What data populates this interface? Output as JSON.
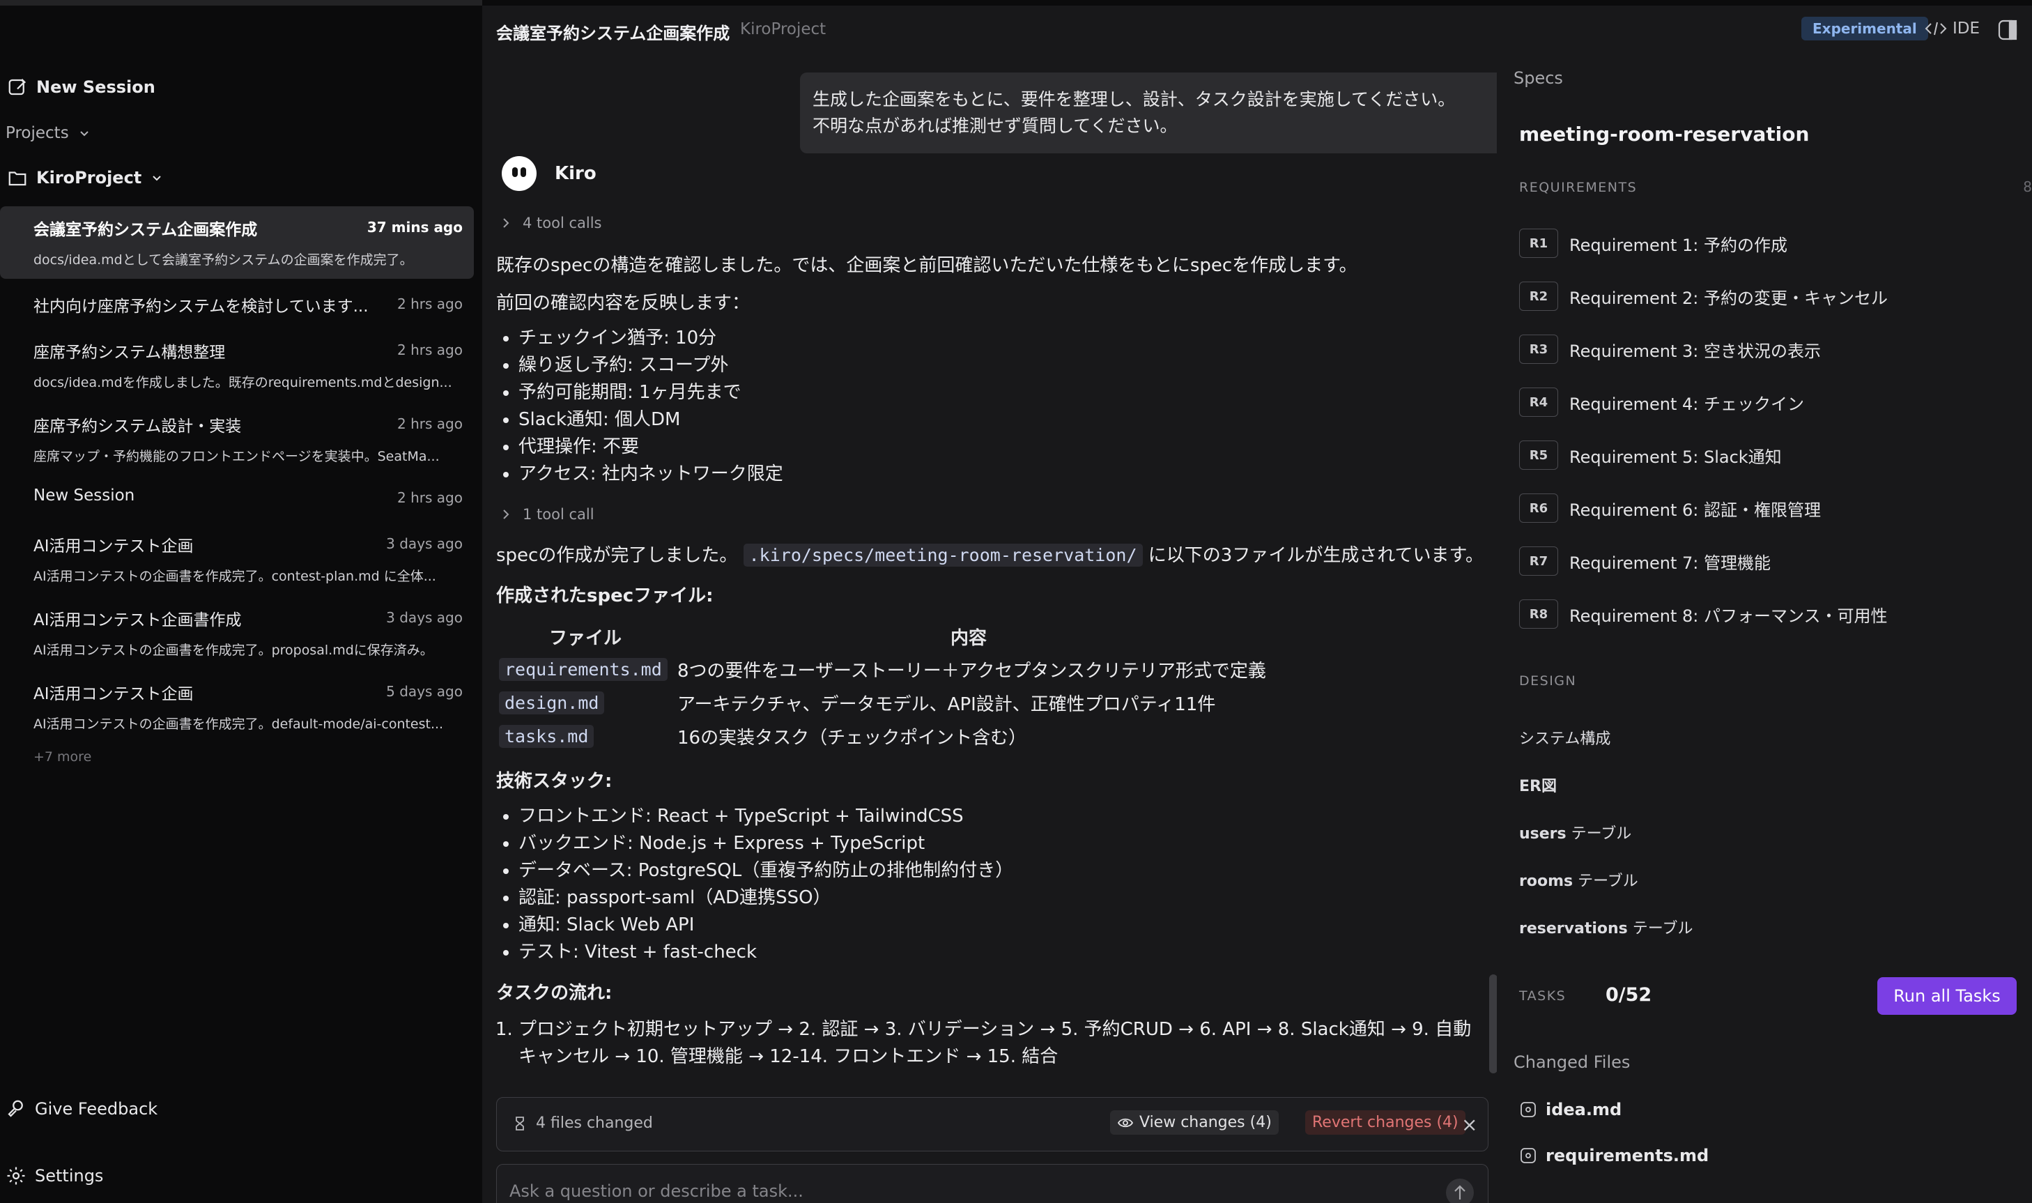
{
  "sidebar": {
    "new_session": "New Session",
    "projects_label": "Projects",
    "project_name": "KiroProject",
    "sessions": [
      {
        "title": "会議室予約システム企画案作成",
        "time": "37 mins ago",
        "subtitle": "docs/idea.mdとして会議室予約システムの企画案を作成完了。"
      },
      {
        "title": "社内向け座席予約システムを検討しています...",
        "time": "2 hrs ago",
        "subtitle": ""
      },
      {
        "title": "座席予約システム構想整理",
        "time": "2 hrs ago",
        "subtitle": "docs/idea.mdを作成しました。既存のrequirements.mdとdesign..."
      },
      {
        "title": "座席予約システム設計・実装",
        "time": "2 hrs ago",
        "subtitle": "座席マップ・予約機能のフロントエンドページを実装中。SeatMa..."
      },
      {
        "title": "New Session",
        "time": "2 hrs ago",
        "subtitle": ""
      },
      {
        "title": "AI活用コンテスト企画",
        "time": "3 days ago",
        "subtitle": "AI活用コンテストの企画書を作成完了。contest-plan.md に全体..."
      },
      {
        "title": "AI活用コンテスト企画書作成",
        "time": "3 days ago",
        "subtitle": "AI活用コンテストの企画書を作成完了。proposal.mdに保存済み。"
      },
      {
        "title": "AI活用コンテスト企画",
        "time": "5 days ago",
        "subtitle": "AI活用コンテストの企画書を作成完了。default-mode/ai-contest..."
      }
    ],
    "more": "+7 more",
    "feedback": "Give Feedback",
    "settings": "Settings"
  },
  "topbar": {
    "title": "会議室予約システム企画案作成",
    "project": "KiroProject",
    "badge": "Experimental",
    "ide": "IDE"
  },
  "chat": {
    "user_message_line1": "生成した企画案をもとに、要件を整理し、設計、タスク設計を実施してください。",
    "user_message_line2": "不明な点があれば推測せず質問してください。",
    "assistant_name": "Kiro",
    "tool_calls_1": "4 tool calls",
    "para1": "既存のspecの構造を確認しました。では、企画案と前回確認いただいた仕様をもとにspecを作成します。",
    "para2": "前回の確認内容を反映します：",
    "confirm_items": [
      "チェックイン猶予: 10分",
      "繰り返し予約: スコープ外",
      "予約可能期間: 1ヶ月先まで",
      "Slack通知: 個人DM",
      "代理操作: 不要",
      "アクセス: 社内ネットワーク限定"
    ],
    "tool_calls_2": "1 tool call",
    "done_prefix": "specの作成が完了しました。",
    "done_path": ".kiro/specs/meeting-room-reservation/",
    "done_suffix": "に以下の3ファイルが生成されています。",
    "files_heading": "作成されたspecファイル:",
    "table_headers": [
      "ファイル",
      "内容"
    ],
    "table_rows": [
      {
        "file": "requirements.md",
        "desc": "8つの要件をユーザーストーリー＋アクセプタンスクリテリア形式で定義"
      },
      {
        "file": "design.md",
        "desc": "アーキテクチャ、データモデル、API設計、正確性プロパティ11件"
      },
      {
        "file": "tasks.md",
        "desc": "16の実装タスク（チェックポイント含む）"
      }
    ],
    "stack_heading": "技術スタック:",
    "stack_items": [
      "フロントエンド: React + TypeScript + TailwindCSS",
      "バックエンド: Node.js + Express + TypeScript",
      "データベース: PostgreSQL（重複予約防止の排他制約付き）",
      "認証: passport-saml（AD連携SSO）",
      "通知: Slack Web API",
      "テスト: Vitest + fast-check"
    ],
    "flow_heading": "タスクの流れ:",
    "flow_items": [
      "プロジェクト初期セットアップ → 2. 認証 → 3. バリデーション → 5. 予約CRUD → 6. API → 8. Slack通知 → 9. 自動キャンセル → 10. 管理機能 → 12-14. フロントエンド → 15. 結合"
    ],
    "files_changed": "4 files changed",
    "view_changes": "View changes (4)",
    "revert_changes": "Revert changes (4)",
    "input_placeholder": "Ask a question or describe a task..."
  },
  "specs": {
    "label": "Specs",
    "name": "meeting-room-reservation",
    "requirements_heading": "REQUIREMENTS",
    "requirements_count": "8",
    "requirements": [
      {
        "tag": "R1",
        "label": "Requirement 1: 予約の作成"
      },
      {
        "tag": "R2",
        "label": "Requirement 2: 予約の変更・キャンセル"
      },
      {
        "tag": "R3",
        "label": "Requirement 3: 空き状況の表示"
      },
      {
        "tag": "R4",
        "label": "Requirement 4: チェックイン"
      },
      {
        "tag": "R5",
        "label": "Requirement 5: Slack通知"
      },
      {
        "tag": "R6",
        "label": "Requirement 6: 認証・権限管理"
      },
      {
        "tag": "R7",
        "label": "Requirement 7: 管理機能"
      },
      {
        "tag": "R8",
        "label": "Requirement 8: パフォーマンス・可用性"
      }
    ],
    "design_heading": "DESIGN",
    "design_items": [
      {
        "bold": "",
        "rest": "システム構成"
      },
      {
        "bold": "ER図",
        "rest": ""
      },
      {
        "bold": "users",
        "rest": " テーブル"
      },
      {
        "bold": "rooms",
        "rest": " テーブル"
      },
      {
        "bold": "reservations",
        "rest": " テーブル"
      }
    ],
    "tasks_heading": "TASKS",
    "tasks_progress": "0/52",
    "run_all": "Run all Tasks",
    "changed_heading": "Changed Files",
    "changed_files": [
      "idea.md",
      "requirements.md"
    ]
  }
}
